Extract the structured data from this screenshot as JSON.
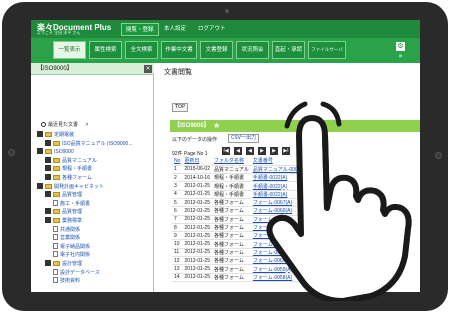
{
  "header": {
    "logo": "楽々Document Plus",
    "welcome": "ようこそ 主田 洋平 さん",
    "tabs": [
      {
        "label": "閲覧・登録",
        "active": true
      },
      {
        "label": "本人設定",
        "active": false
      },
      {
        "label": "ログアウト",
        "active": false
      }
    ]
  },
  "nav": {
    "buttons": [
      "一覧表示",
      "属性検索",
      "全文検索",
      "作業中文書",
      "文書登録",
      "状況照会",
      "直起・承認",
      "ファイルサーバ"
    ],
    "gear_icon": "⚙",
    "arrow_icon": "»"
  },
  "left_panel": {
    "title": "【ISO9000】",
    "close_icon": "×",
    "recent_label": "最近見た文書",
    "recent_arrow": ">",
    "tree": [
      {
        "label": "定期電装",
        "level": 0,
        "link": true
      },
      {
        "label": "ISO品質マニュアル (ISO9000...",
        "level": 1,
        "link": true
      },
      {
        "label": "ISO9000",
        "level": 0,
        "link": true
      },
      {
        "label": "品質マニュアル",
        "level": 1,
        "link": true
      },
      {
        "label": "規程・手順書",
        "level": 1,
        "link": true
      },
      {
        "label": "各種フォーム",
        "level": 1,
        "link": true
      },
      {
        "label": "開発計画キャビネット",
        "level": 0,
        "link": true
      },
      {
        "label": "品質管理",
        "level": 1,
        "link": true
      },
      {
        "label": "施工・手順書",
        "level": 2,
        "link": true
      },
      {
        "label": "品質管理",
        "level": 1,
        "link": true
      },
      {
        "label": "業務標準",
        "level": 1,
        "link": true
      },
      {
        "label": "共通関係",
        "level": 2,
        "link": true
      },
      {
        "label": "営業関係",
        "level": 2,
        "link": true
      },
      {
        "label": "電子納品関係",
        "level": 2,
        "link": true
      },
      {
        "label": "電子社内関係",
        "level": 2,
        "link": true
      },
      {
        "label": "設計管理",
        "level": 1,
        "link": true
      },
      {
        "label": "設計データベース",
        "level": 2,
        "link": true
      },
      {
        "label": "技術資料",
        "level": 2,
        "link": true
      }
    ]
  },
  "main": {
    "title": "文書閲覧",
    "top_button": "TOP",
    "section_title": "【ISO9000】",
    "section_star": "★",
    "subtext": "以下のデータの操作",
    "csv_link": "CSV一出力",
    "pager_text": "92件 Page No 1",
    "pager_buttons": [
      "I◀",
      "◀",
      "◀",
      "▶",
      "▶",
      "▶I"
    ],
    "table": {
      "headers": [
        "No",
        "更新日",
        "フォルダ名称",
        "文書番号"
      ],
      "rows": [
        [
          "1",
          "2015-06-02",
          "品質マニュアル",
          "品質マニュアル-0001(B)"
        ],
        [
          "2",
          "2014-10-16",
          "規程・手順書",
          "手順書-0022(A)"
        ],
        [
          "3",
          "2012-01-25",
          "規程・手順書",
          "手順書-0022(A)"
        ],
        [
          "4",
          "2012-01-25",
          "規程・手順書",
          "手順書-0022(A)"
        ],
        [
          "5",
          "2012-01-25",
          "各種フォーム",
          "フォーム-0067(A)"
        ],
        [
          "6",
          "2012-01-25",
          "各種フォーム",
          "フォーム-0066(A)"
        ],
        [
          "7",
          "2012-01-25",
          "各種フォーム",
          "フォーム-0065(A)"
        ],
        [
          "8",
          "2012-01-25",
          "各種フォーム",
          "フォーム-0064(A)"
        ],
        [
          "9",
          "2012-01-25",
          "各種フォーム",
          "フォーム-0063(A)"
        ],
        [
          "10",
          "2012-01-25",
          "各種フォーム",
          "フォーム-0062(A)"
        ],
        [
          "11",
          "2012-01-25",
          "各種フォーム",
          "フォーム-0061(A)"
        ],
        [
          "12",
          "2012-01-25",
          "各種フォーム",
          "フォーム-0060(A)"
        ],
        [
          "13",
          "2012-01-25",
          "各種フォーム",
          "フォーム-0059(A)"
        ],
        [
          "14",
          "2012-01-25",
          "各種フォーム",
          "フォーム-0058(A)"
        ]
      ]
    }
  },
  "colors": {
    "header_green": "#1f8a3b",
    "nav_green": "#2aa24a",
    "section_bar": "#8fd14f",
    "link_blue": "#1a4fb0"
  }
}
